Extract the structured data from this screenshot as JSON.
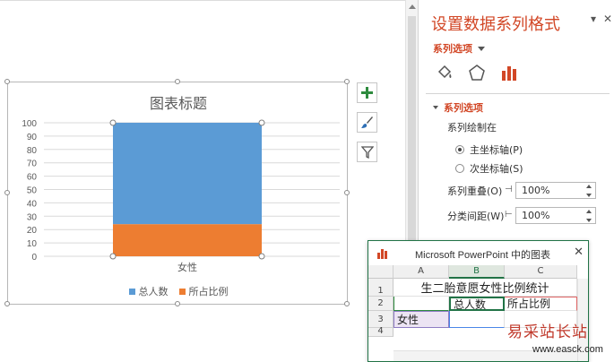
{
  "chart": {
    "title": "图表标题",
    "legend": [
      "总人数",
      "所占比例"
    ],
    "category_label": "女性"
  },
  "chart_data": {
    "type": "bar",
    "stacked": true,
    "categories": [
      "女性"
    ],
    "series": [
      {
        "name": "总人数",
        "values": [
          100
        ],
        "color": "#5b9bd5"
      },
      {
        "name": "所占比例",
        "values": [
          24
        ],
        "color": "#ed7d31"
      }
    ],
    "ylim": [
      0,
      100
    ],
    "yticks": [
      0,
      10,
      20,
      30,
      40,
      50,
      60,
      70,
      80,
      90,
      100
    ],
    "grid": true,
    "legend_position": "bottom"
  },
  "chart_buttons": {
    "add_elements": "+",
    "styles": "brush",
    "filters": "funnel"
  },
  "pane": {
    "title": "设置数据系列格式",
    "options_dropdown": "系列选项",
    "section": "系列选项",
    "plot_on_label": "系列绘制在",
    "primary_axis": "主坐标轴(P)",
    "secondary_axis": "次坐标轴(S)",
    "overlap_label": "系列重叠(O)",
    "overlap_value": "100%",
    "gap_label": "分类间距(W)",
    "gap_value": "100%",
    "pin_icon": "▾",
    "close_icon": "✕"
  },
  "sheet": {
    "title": "Microsoft PowerPoint 中的图表",
    "close_icon": "✕",
    "columns": [
      "A",
      "B",
      "C"
    ],
    "rows": [
      "1",
      "2",
      "3",
      "4"
    ],
    "cells": {
      "r1": "生二胎意愿女性比例统计",
      "b2": "总人数",
      "c2": "所占比例",
      "a3": "女性"
    }
  },
  "watermark": {
    "text": "易采站长站",
    "url": "www.easck.com"
  }
}
